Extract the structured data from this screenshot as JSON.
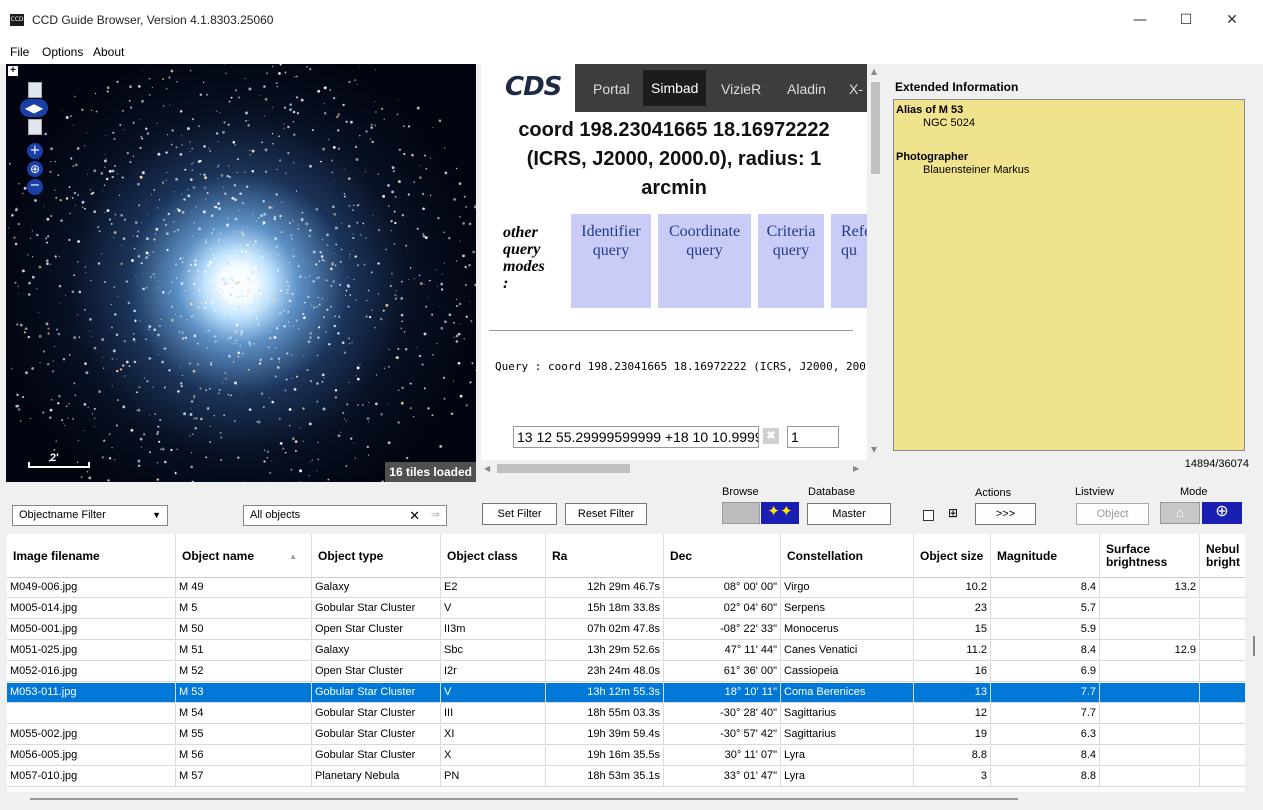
{
  "window": {
    "title": "CCD Guide Browser, Version 4.1.8303.25060",
    "icon_text": "CCD",
    "minimize": "—",
    "maximize": "☐",
    "close": "✕"
  },
  "menu": [
    "File",
    "Options",
    "About"
  ],
  "viewer": {
    "scale_label": "2'",
    "tiles_loaded": "16 tiles loaded",
    "controls": [
      "expand-icon",
      "image-thumb-icon",
      "pan-arrows-icon",
      "zoom-in-icon",
      "globe-icon",
      "zoom-out-icon"
    ]
  },
  "simbad": {
    "logo": "CDS",
    "tabs": [
      "Portal",
      "Simbad",
      "VizieR",
      "Aladin",
      "X-"
    ],
    "active_tab": "Simbad",
    "title_lines": [
      "coord 198.23041665 18.16972222",
      "(ICRS, J2000, 2000.0), radius: 1",
      "arcmin"
    ],
    "other_modes": [
      "other",
      "query",
      "modes",
      ":"
    ],
    "query_buttons": [
      {
        "line1": "Identifier",
        "line2": "query"
      },
      {
        "line1": "Coordinate",
        "line2": "query"
      },
      {
        "line1": "Criteria",
        "line2": "query"
      },
      {
        "line1": "Refe",
        "line2": "qu"
      }
    ],
    "query_text": "Query : coord 198.23041665 18.16972222 (ICRS, J2000, 200",
    "coord_input": "13 12 55.29999599999 +18 10 10.9999",
    "clear": "✖",
    "radius_input": "1"
  },
  "extended": {
    "label": "Extended Information",
    "entries": [
      {
        "key": "Alias of M 53",
        "value": "NGC 5024"
      },
      {
        "key": "Photographer",
        "value": "Blauensteiner Markus"
      }
    ],
    "count": "14894/36074"
  },
  "toolbar": {
    "filter_select": "Objectname Filter",
    "filter_value": "All objects",
    "clear_icon": "✕",
    "go_icon": "⇒",
    "set_filter": "Set Filter",
    "reset_filter": "Reset Filter",
    "browse_label": "Browse",
    "database_label": "Database",
    "database_value": "Master",
    "actions_label": "Actions",
    "actions_button": ">>>",
    "grid_icon": "⊞",
    "listview_label": "Listview",
    "listview_value": "Object",
    "mode_label": "Mode",
    "house_icon": "⌂",
    "globe_icon": "⊕",
    "stars_icon": "✦✦"
  },
  "table": {
    "columns": [
      {
        "label": "Image filename"
      },
      {
        "label": "Object name",
        "sort": "▲"
      },
      {
        "label": "Object type"
      },
      {
        "label": "Object class"
      },
      {
        "label": "Ra"
      },
      {
        "label": "Dec"
      },
      {
        "label": "Constellation"
      },
      {
        "label": "Object size"
      },
      {
        "label": "Magnitude"
      },
      {
        "label": "Surface brightness"
      },
      {
        "label": "Nebul bright"
      }
    ],
    "rows": [
      [
        "M049-006.jpg",
        "M 49",
        "Galaxy",
        "E2",
        "12h 29m 46.7s",
        "08° 00' 00\"",
        "Virgo",
        "10.2",
        "8.4",
        "13.2",
        ""
      ],
      [
        "M005-014.jpg",
        "M 5",
        "Gobular Star Cluster",
        "V",
        "15h 18m 33.8s",
        "02° 04' 60\"",
        "Serpens",
        "23",
        "5.7",
        "",
        ""
      ],
      [
        "M050-001.jpg",
        "M 50",
        "Open Star Cluster",
        "II3m",
        "07h 02m 47.8s",
        "-08° 22' 33\"",
        "Monocerus",
        "15",
        "5.9",
        "",
        ""
      ],
      [
        "M051-025.jpg",
        "M 51",
        "Galaxy",
        "Sbc",
        "13h 29m 52.6s",
        "47° 11' 44\"",
        "Canes Venatici",
        "11.2",
        "8.4",
        "12.9",
        ""
      ],
      [
        "M052-016.jpg",
        "M 52",
        "Open Star Cluster",
        "I2r",
        "23h 24m 48.0s",
        "61° 36' 00\"",
        "Cassiopeia",
        "16",
        "6.9",
        "",
        ""
      ],
      [
        "M053-011.jpg",
        "M 53",
        "Gobular Star Cluster",
        "V",
        "13h 12m 55.3s",
        "18° 10' 11\"",
        "Coma Berenices",
        "13",
        "7.7",
        "",
        ""
      ],
      [
        "",
        "M 54",
        "Gobular Star Cluster",
        "III",
        "18h 55m 03.3s",
        "-30° 28' 40\"",
        "Sagittarius",
        "12",
        "7.7",
        "",
        ""
      ],
      [
        "M055-002.jpg",
        "M 55",
        "Gobular Star Cluster",
        "XI",
        "19h 39m 59.4s",
        "-30° 57' 42\"",
        "Sagittarius",
        "19",
        "6.3",
        "",
        ""
      ],
      [
        "M056-005.jpg",
        "M 56",
        "Gobular Star Cluster",
        "X",
        "19h 16m 35.5s",
        "30° 11' 07\"",
        "Lyra",
        "8.8",
        "8.4",
        "",
        ""
      ],
      [
        "M057-010.jpg",
        "M 57",
        "Planetary Nebula",
        "PN",
        "18h 53m 35.1s",
        "33° 01' 47\"",
        "Lyra",
        "3",
        "8.8",
        "",
        ""
      ]
    ],
    "selected_index": 5
  }
}
